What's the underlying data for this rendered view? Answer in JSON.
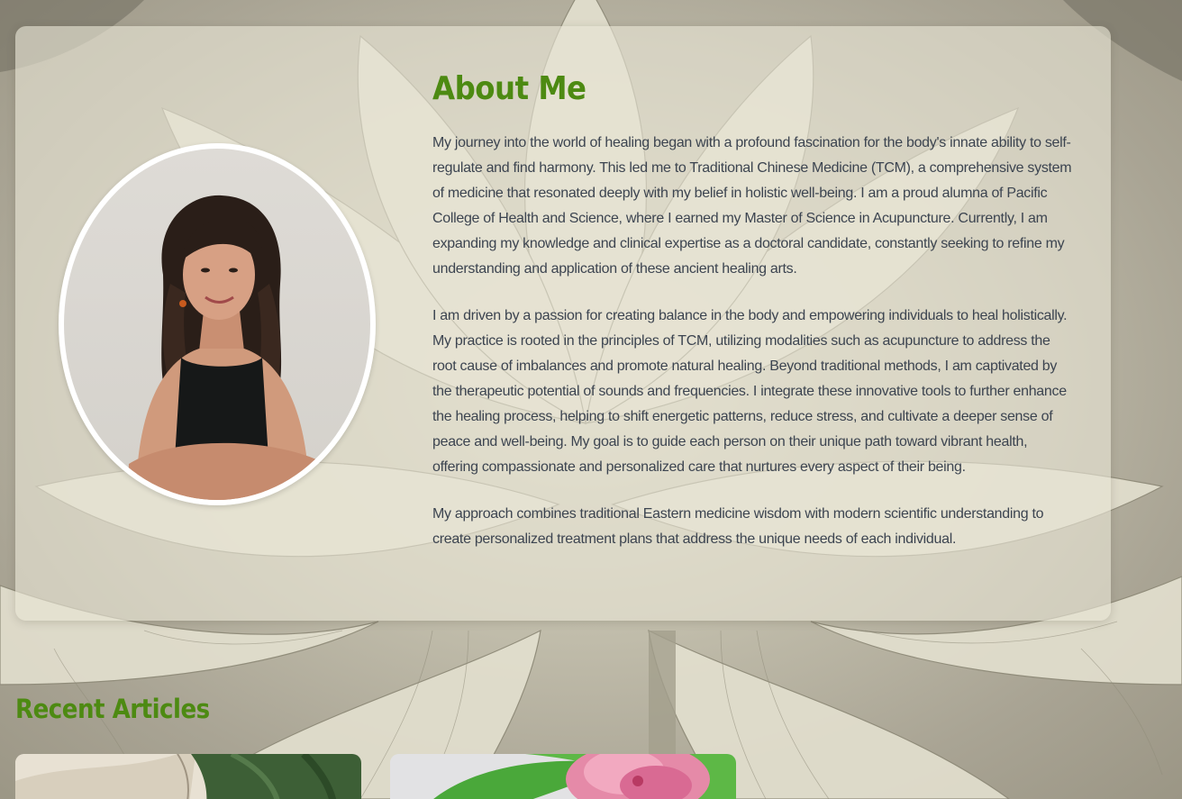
{
  "about": {
    "title": "About Me",
    "portrait_alt": "Portrait photo",
    "paragraphs": [
      "My journey into the world of healing began with a profound fascination for the body's innate ability to self-regulate and find harmony. This led me to Traditional Chinese Medicine (TCM), a comprehensive system of medicine that resonated deeply with my belief in holistic well-being. I am a proud alumna of Pacific College of Health and Science, where I earned my Master of Science in Acupuncture. Currently, I am expanding my knowledge and clinical expertise as a doctoral candidate, constantly seeking to refine my understanding and application of these ancient healing arts.",
      "I am driven by a passion for creating balance in the body and empowering individuals to heal holistically. My practice is rooted in the principles of TCM, utilizing modalities such as acupuncture to address the root cause of imbalances and promote natural healing. Beyond traditional methods, I am captivated by the therapeutic potential of sounds and frequencies. I integrate these innovative tools to further enhance the healing process, helping to shift energetic patterns, reduce stress, and cultivate a deeper sense of peace and well-being. My goal is to guide each person on their unique path toward vibrant health, offering compassionate and personalized care that nurtures every aspect of their being.",
      "My approach combines traditional Eastern medicine wisdom with modern scientific understanding to create personalized treatment plans that address the unique needs of each individual."
    ]
  },
  "recent_articles": {
    "title": "Recent Articles"
  },
  "colors": {
    "heading": "#4d8a12",
    "body_text": "#3c4450",
    "card_bg": "rgba(232,229,213,0.62)"
  }
}
